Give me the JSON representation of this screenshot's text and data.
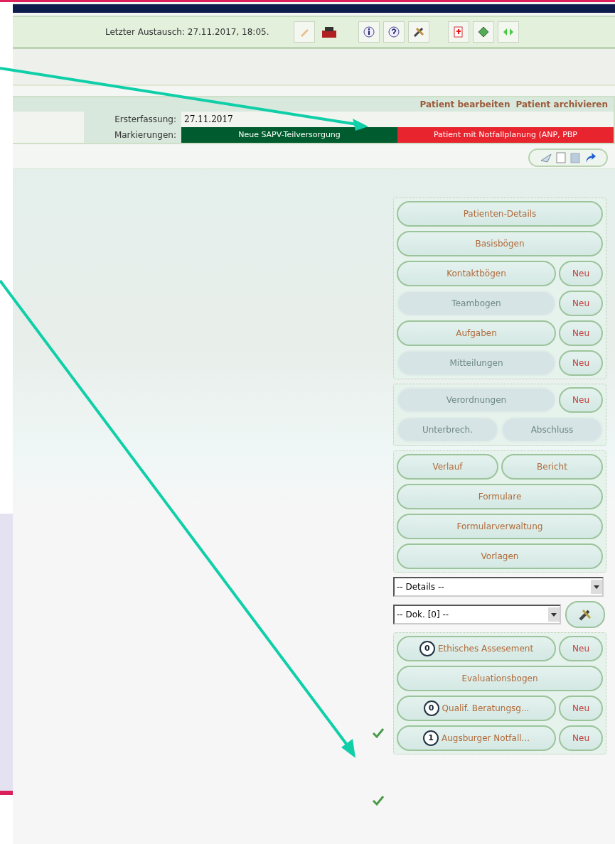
{
  "toolbar": {
    "last_exchange": "Letzter Austausch: 27.11.2017, 18:05."
  },
  "patient": {
    "actions": [
      "Patient bearbeiten",
      "Patient archivieren"
    ],
    "fields": [
      {
        "label": "Ersterfassung:",
        "value": "27.11.2017"
      }
    ],
    "markings_label": "Markierungen:",
    "markings": [
      {
        "label": "Neue SAPV-Teilversorgung",
        "color": "#005c2e"
      },
      {
        "label": "Patient mit Notfallplanung (ANP, PBP",
        "color": "#e8252f"
      }
    ]
  },
  "groups": [
    {
      "rows": [
        [
          {
            "kind": "main",
            "label": "Patienten-Details",
            "disabled": false
          }
        ],
        [
          {
            "kind": "main",
            "label": "Basisbögen",
            "disabled": false
          }
        ],
        [
          {
            "kind": "main",
            "label": "Kontaktbögen",
            "disabled": false
          },
          {
            "kind": "new",
            "label": "Neu",
            "disabled": false
          }
        ],
        [
          {
            "kind": "main",
            "label": "Teambogen",
            "disabled": true
          },
          {
            "kind": "new",
            "label": "Neu",
            "disabled": false
          }
        ],
        [
          {
            "kind": "main",
            "label": "Aufgaben",
            "disabled": false
          },
          {
            "kind": "new",
            "label": "Neu",
            "disabled": false
          }
        ],
        [
          {
            "kind": "main",
            "label": "Mitteilungen",
            "disabled": true
          },
          {
            "kind": "new",
            "label": "Neu",
            "disabled": false
          }
        ]
      ]
    },
    {
      "rows": [
        [
          {
            "kind": "main",
            "label": "Verordnungen",
            "disabled": true
          },
          {
            "kind": "new",
            "label": "Neu",
            "disabled": false
          }
        ],
        [
          {
            "kind": "main",
            "label": "Unterbrech.",
            "disabled": true
          },
          {
            "kind": "main",
            "label": "Abschluss",
            "disabled": true
          }
        ]
      ]
    },
    {
      "rows": [
        [
          {
            "kind": "main",
            "label": "Verlauf",
            "disabled": false
          },
          {
            "kind": "main",
            "label": "Bericht",
            "disabled": false
          }
        ],
        [
          {
            "kind": "main",
            "label": "Formulare",
            "disabled": false
          }
        ],
        [
          {
            "kind": "main",
            "label": "Formularverwaltung",
            "disabled": false
          }
        ],
        [
          {
            "kind": "main",
            "label": "Vorlagen",
            "disabled": false
          }
        ]
      ]
    }
  ],
  "selects": [
    {
      "value": "-- Details --"
    },
    {
      "value": "-- Dok. [0] --"
    }
  ],
  "forms": [
    {
      "count": "0",
      "label": "Ethisches Assesement",
      "new": "Neu"
    },
    {
      "label": "Evaluationsbogen"
    },
    {
      "count": "0",
      "label": "Qualif. Beratungsg...",
      "new": "Neu"
    },
    {
      "count": "1",
      "label": "Augsburger Notfall...",
      "new": "Neu"
    }
  ]
}
